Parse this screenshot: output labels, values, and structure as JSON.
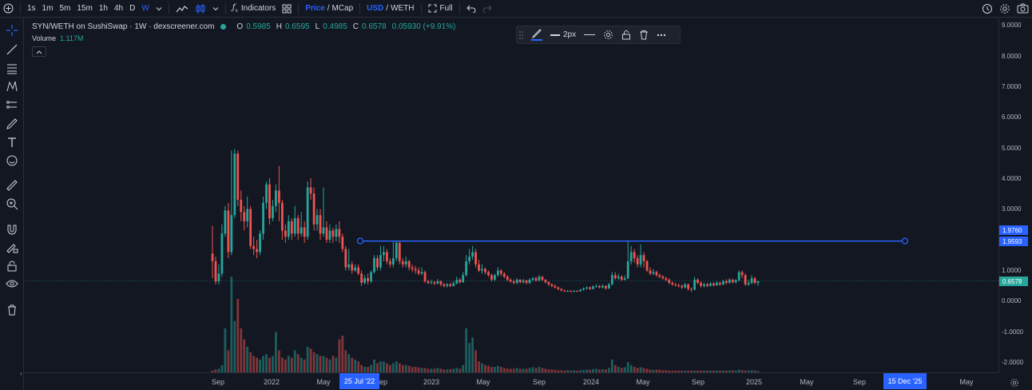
{
  "toolbar": {
    "intervals": [
      "1s",
      "1m",
      "5m",
      "15m",
      "1h",
      "4h",
      "D",
      "W"
    ],
    "active_interval": "W",
    "indicators_label": "Indicators",
    "price_label": "Price",
    "mcap_label": "MCap",
    "slash": "/",
    "usd_label": "USD",
    "weth_label": "WETH",
    "full_label": "Full"
  },
  "legend": {
    "symbol": "SYN/WETH on SushiSwap · 1W · dexscreener.com",
    "o_key": "O",
    "o_val": "0.5985",
    "h_key": "H",
    "h_val": "0.6595",
    "l_key": "L",
    "l_val": "0.4985",
    "c_key": "C",
    "c_val": "0.6578",
    "change": "0.05930 (+9.91%)",
    "volume_key": "Volume",
    "volume_val": "1.117M"
  },
  "drawing_toolbar": {
    "width_label": "2px"
  },
  "price_axis": {
    "labels": [
      "9.0000",
      "8.0000",
      "7.0000",
      "6.0000",
      "5.0000",
      "4.0000",
      "3.0000",
      "1.0000",
      "0.0000",
      "-1.0000",
      "-2.0000"
    ],
    "tag_line_top": "1.9760",
    "tag_line_bottom": "1.9593",
    "tag_current": "0.6578"
  },
  "time_axis": {
    "labels": [
      "Sep",
      "2022",
      "May",
      "Sep",
      "2023",
      "May",
      "Sep",
      "2024",
      "May",
      "Sep",
      "2025",
      "May",
      "Sep",
      "May"
    ],
    "tag_left": "25 Jul '22",
    "tag_right": "15 Dec '25"
  },
  "colors": {
    "up": "#26a69a",
    "down": "#ef5350",
    "line": "#2962ff",
    "bg": "#131722"
  },
  "chart_data": {
    "type": "candlestick",
    "current_price": 0.6578,
    "horizontal_line": 1.9593,
    "candles": [
      {
        "o": 1.55,
        "c": 1.3,
        "h": 2.45,
        "l": 0.75
      },
      {
        "o": 1.3,
        "c": 0.65,
        "h": 1.45,
        "l": 0.55
      },
      {
        "o": 0.65,
        "c": 0.9,
        "h": 1.2,
        "l": 0.55
      },
      {
        "o": 0.9,
        "c": 2.2,
        "h": 2.5,
        "l": 0.8
      },
      {
        "o": 2.2,
        "c": 2.95,
        "h": 3.1,
        "l": 2.1
      },
      {
        "o": 2.95,
        "c": 1.6,
        "h": 3.2,
        "l": 1.4
      },
      {
        "o": 1.6,
        "c": 2.8,
        "h": 4.9,
        "l": 1.5
      },
      {
        "o": 2.8,
        "c": 4.8,
        "h": 4.95,
        "l": 2.7
      },
      {
        "o": 4.8,
        "c": 3.3,
        "h": 4.9,
        "l": 3.1
      },
      {
        "o": 3.3,
        "c": 2.9,
        "h": 3.6,
        "l": 2.6
      },
      {
        "o": 2.9,
        "c": 2.6,
        "h": 3.1,
        "l": 2.3
      },
      {
        "o": 2.6,
        "c": 3.0,
        "h": 3.4,
        "l": 2.4
      },
      {
        "o": 3.0,
        "c": 1.8,
        "h": 3.1,
        "l": 1.7
      },
      {
        "o": 1.8,
        "c": 1.7,
        "h": 2.1,
        "l": 1.5
      },
      {
        "o": 1.7,
        "c": 1.6,
        "h": 2.0,
        "l": 1.4
      },
      {
        "o": 1.6,
        "c": 2.2,
        "h": 2.3,
        "l": 1.5
      },
      {
        "o": 2.2,
        "c": 3.2,
        "h": 3.4,
        "l": 2.0
      },
      {
        "o": 3.2,
        "c": 3.8,
        "h": 3.9,
        "l": 3.0
      },
      {
        "o": 3.8,
        "c": 2.7,
        "h": 4.0,
        "l": 2.5
      },
      {
        "o": 2.7,
        "c": 3.1,
        "h": 3.3,
        "l": 2.6
      },
      {
        "o": 3.1,
        "c": 3.6,
        "h": 3.8,
        "l": 2.9
      },
      {
        "o": 3.6,
        "c": 3.2,
        "h": 4.4,
        "l": 2.6
      },
      {
        "o": 3.2,
        "c": 2.3,
        "h": 3.3,
        "l": 2.0
      },
      {
        "o": 2.3,
        "c": 2.1,
        "h": 2.5,
        "l": 1.9
      },
      {
        "o": 2.1,
        "c": 2.6,
        "h": 2.8,
        "l": 2.0
      },
      {
        "o": 2.6,
        "c": 2.2,
        "h": 2.7,
        "l": 2.0
      },
      {
        "o": 2.2,
        "c": 2.7,
        "h": 3.1,
        "l": 2.1
      },
      {
        "o": 2.7,
        "c": 2.2,
        "h": 2.8,
        "l": 2.0
      },
      {
        "o": 2.2,
        "c": 2.4,
        "h": 2.9,
        "l": 2.1
      },
      {
        "o": 2.4,
        "c": 2.1,
        "h": 2.6,
        "l": 1.9
      },
      {
        "o": 2.1,
        "c": 3.7,
        "h": 3.9,
        "l": 2.0
      },
      {
        "o": 3.7,
        "c": 3.5,
        "h": 4.0,
        "l": 3.3
      },
      {
        "o": 3.5,
        "c": 2.5,
        "h": 3.7,
        "l": 2.3
      },
      {
        "o": 2.5,
        "c": 2.8,
        "h": 3.0,
        "l": 2.3
      },
      {
        "o": 2.8,
        "c": 2.2,
        "h": 3.0,
        "l": 2.0
      },
      {
        "o": 2.2,
        "c": 2.4,
        "h": 3.7,
        "l": 2.1
      },
      {
        "o": 2.4,
        "c": 2.0,
        "h": 2.6,
        "l": 1.9
      },
      {
        "o": 2.0,
        "c": 2.3,
        "h": 2.5,
        "l": 1.9
      },
      {
        "o": 2.3,
        "c": 2.1,
        "h": 2.4,
        "l": 1.9
      },
      {
        "o": 2.1,
        "c": 2.35,
        "h": 2.5,
        "l": 1.95
      },
      {
        "o": 2.35,
        "c": 2.1,
        "h": 2.6,
        "l": 1.9
      },
      {
        "o": 2.1,
        "c": 1.7,
        "h": 2.2,
        "l": 1.6
      },
      {
        "o": 1.7,
        "c": 1.1,
        "h": 1.8,
        "l": 1.0
      },
      {
        "o": 1.1,
        "c": 1.2,
        "h": 1.7,
        "l": 1.0
      },
      {
        "o": 1.2,
        "c": 1.0,
        "h": 1.3,
        "l": 0.9
      },
      {
        "o": 1.0,
        "c": 1.1,
        "h": 1.2,
        "l": 0.95
      },
      {
        "o": 1.1,
        "c": 0.9,
        "h": 1.2,
        "l": 0.85
      },
      {
        "o": 0.9,
        "c": 0.6,
        "h": 1.0,
        "l": 0.5
      },
      {
        "o": 0.6,
        "c": 0.75,
        "h": 0.85,
        "l": 0.55
      },
      {
        "o": 0.75,
        "c": 0.65,
        "h": 0.9,
        "l": 0.55
      },
      {
        "o": 0.65,
        "c": 0.95,
        "h": 1.0,
        "l": 0.6
      },
      {
        "o": 0.95,
        "c": 1.4,
        "h": 1.5,
        "l": 0.9
      },
      {
        "o": 1.4,
        "c": 1.1,
        "h": 1.5,
        "l": 1.0
      },
      {
        "o": 1.1,
        "c": 1.5,
        "h": 1.8,
        "l": 1.0
      },
      {
        "o": 1.5,
        "c": 1.6,
        "h": 1.8,
        "l": 1.3
      },
      {
        "o": 1.6,
        "c": 1.3,
        "h": 1.7,
        "l": 1.2
      },
      {
        "o": 1.3,
        "c": 1.2,
        "h": 1.4,
        "l": 1.1
      },
      {
        "o": 1.2,
        "c": 1.4,
        "h": 1.96,
        "l": 1.1
      },
      {
        "o": 1.4,
        "c": 1.9,
        "h": 1.96,
        "l": 1.3
      },
      {
        "o": 1.9,
        "c": 1.3,
        "h": 1.95,
        "l": 1.2
      },
      {
        "o": 1.3,
        "c": 1.2,
        "h": 1.4,
        "l": 1.1
      },
      {
        "o": 1.2,
        "c": 1.3,
        "h": 1.45,
        "l": 1.1
      },
      {
        "o": 1.3,
        "c": 1.1,
        "h": 1.35,
        "l": 1.0
      },
      {
        "o": 1.1,
        "c": 1.05,
        "h": 1.2,
        "l": 0.95
      },
      {
        "o": 1.05,
        "c": 1.0,
        "h": 1.15,
        "l": 0.9
      },
      {
        "o": 1.0,
        "c": 0.9,
        "h": 1.1,
        "l": 0.85
      },
      {
        "o": 0.9,
        "c": 0.95,
        "h": 1.1,
        "l": 0.85
      },
      {
        "o": 0.95,
        "c": 0.65,
        "h": 1.0,
        "l": 0.6
      },
      {
        "o": 0.65,
        "c": 0.6,
        "h": 0.7,
        "l": 0.55
      },
      {
        "o": 0.6,
        "c": 0.62,
        "h": 0.7,
        "l": 0.55
      },
      {
        "o": 0.62,
        "c": 0.58,
        "h": 0.66,
        "l": 0.52
      },
      {
        "o": 0.58,
        "c": 0.65,
        "h": 0.72,
        "l": 0.55
      },
      {
        "o": 0.65,
        "c": 0.55,
        "h": 0.68,
        "l": 0.48
      },
      {
        "o": 0.55,
        "c": 0.5,
        "h": 0.6,
        "l": 0.45
      },
      {
        "o": 0.5,
        "c": 0.55,
        "h": 0.6,
        "l": 0.45
      },
      {
        "o": 0.55,
        "c": 0.5,
        "h": 0.6,
        "l": 0.46
      },
      {
        "o": 0.5,
        "c": 0.58,
        "h": 0.65,
        "l": 0.48
      },
      {
        "o": 0.58,
        "c": 0.7,
        "h": 0.8,
        "l": 0.55
      },
      {
        "o": 0.7,
        "c": 0.62,
        "h": 0.75,
        "l": 0.58
      },
      {
        "o": 0.62,
        "c": 0.85,
        "h": 0.95,
        "l": 0.6
      },
      {
        "o": 0.85,
        "c": 1.3,
        "h": 1.5,
        "l": 0.8
      },
      {
        "o": 1.3,
        "c": 1.45,
        "h": 1.7,
        "l": 1.2
      },
      {
        "o": 1.45,
        "c": 1.6,
        "h": 1.8,
        "l": 1.35
      },
      {
        "o": 1.6,
        "c": 1.2,
        "h": 1.7,
        "l": 1.1
      },
      {
        "o": 1.2,
        "c": 1.0,
        "h": 1.35,
        "l": 0.95
      },
      {
        "o": 1.0,
        "c": 1.05,
        "h": 1.2,
        "l": 0.9
      },
      {
        "o": 1.05,
        "c": 0.95,
        "h": 1.1,
        "l": 0.88
      },
      {
        "o": 0.95,
        "c": 0.85,
        "h": 1.0,
        "l": 0.8
      },
      {
        "o": 0.85,
        "c": 0.7,
        "h": 0.9,
        "l": 0.65
      },
      {
        "o": 0.7,
        "c": 0.85,
        "h": 0.9,
        "l": 0.65
      },
      {
        "o": 0.85,
        "c": 1.0,
        "h": 1.1,
        "l": 0.8
      },
      {
        "o": 1.0,
        "c": 0.9,
        "h": 1.05,
        "l": 0.82
      },
      {
        "o": 0.9,
        "c": 0.8,
        "h": 0.95,
        "l": 0.75
      },
      {
        "o": 0.8,
        "c": 0.7,
        "h": 0.85,
        "l": 0.65
      },
      {
        "o": 0.7,
        "c": 0.65,
        "h": 0.75,
        "l": 0.6
      },
      {
        "o": 0.65,
        "c": 0.6,
        "h": 0.7,
        "l": 0.55
      },
      {
        "o": 0.6,
        "c": 0.7,
        "h": 0.75,
        "l": 0.55
      },
      {
        "o": 0.7,
        "c": 0.62,
        "h": 0.72,
        "l": 0.58
      },
      {
        "o": 0.62,
        "c": 0.68,
        "h": 0.72,
        "l": 0.58
      },
      {
        "o": 0.68,
        "c": 0.6,
        "h": 0.7,
        "l": 0.55
      },
      {
        "o": 0.6,
        "c": 0.7,
        "h": 0.75,
        "l": 0.56
      },
      {
        "o": 0.7,
        "c": 0.75,
        "h": 0.8,
        "l": 0.65
      },
      {
        "o": 0.75,
        "c": 0.68,
        "h": 0.8,
        "l": 0.63
      },
      {
        "o": 0.68,
        "c": 0.8,
        "h": 0.85,
        "l": 0.65
      },
      {
        "o": 0.8,
        "c": 0.7,
        "h": 0.82,
        "l": 0.66
      },
      {
        "o": 0.7,
        "c": 0.62,
        "h": 0.72,
        "l": 0.58
      },
      {
        "o": 0.62,
        "c": 0.55,
        "h": 0.65,
        "l": 0.5
      },
      {
        "o": 0.55,
        "c": 0.5,
        "h": 0.58,
        "l": 0.45
      },
      {
        "o": 0.5,
        "c": 0.45,
        "h": 0.55,
        "l": 0.42
      },
      {
        "o": 0.45,
        "c": 0.4,
        "h": 0.48,
        "l": 0.36
      },
      {
        "o": 0.4,
        "c": 0.35,
        "h": 0.43,
        "l": 0.32
      },
      {
        "o": 0.35,
        "c": 0.33,
        "h": 0.38,
        "l": 0.3
      },
      {
        "o": 0.33,
        "c": 0.34,
        "h": 0.37,
        "l": 0.3
      },
      {
        "o": 0.34,
        "c": 0.32,
        "h": 0.36,
        "l": 0.29
      },
      {
        "o": 0.32,
        "c": 0.34,
        "h": 0.37,
        "l": 0.3
      },
      {
        "o": 0.34,
        "c": 0.33,
        "h": 0.36,
        "l": 0.3
      },
      {
        "o": 0.33,
        "c": 0.38,
        "h": 0.4,
        "l": 0.31
      },
      {
        "o": 0.38,
        "c": 0.42,
        "h": 0.45,
        "l": 0.35
      },
      {
        "o": 0.42,
        "c": 0.45,
        "h": 0.48,
        "l": 0.38
      },
      {
        "o": 0.45,
        "c": 0.4,
        "h": 0.48,
        "l": 0.37
      },
      {
        "o": 0.4,
        "c": 0.48,
        "h": 0.52,
        "l": 0.38
      },
      {
        "o": 0.48,
        "c": 0.5,
        "h": 0.55,
        "l": 0.44
      },
      {
        "o": 0.5,
        "c": 0.45,
        "h": 0.53,
        "l": 0.42
      },
      {
        "o": 0.45,
        "c": 0.5,
        "h": 0.55,
        "l": 0.42
      },
      {
        "o": 0.5,
        "c": 0.42,
        "h": 0.52,
        "l": 0.38
      },
      {
        "o": 0.42,
        "c": 0.55,
        "h": 0.6,
        "l": 0.4
      },
      {
        "o": 0.55,
        "c": 0.85,
        "h": 0.95,
        "l": 0.52
      },
      {
        "o": 0.85,
        "c": 0.75,
        "h": 0.95,
        "l": 0.7
      },
      {
        "o": 0.75,
        "c": 0.8,
        "h": 0.9,
        "l": 0.7
      },
      {
        "o": 0.8,
        "c": 0.7,
        "h": 0.85,
        "l": 0.65
      },
      {
        "o": 0.7,
        "c": 0.75,
        "h": 0.85,
        "l": 0.68
      },
      {
        "o": 0.75,
        "c": 1.3,
        "h": 1.96,
        "l": 0.72
      },
      {
        "o": 1.3,
        "c": 1.6,
        "h": 1.8,
        "l": 1.2
      },
      {
        "o": 1.6,
        "c": 1.4,
        "h": 1.7,
        "l": 1.25
      },
      {
        "o": 1.4,
        "c": 1.2,
        "h": 1.5,
        "l": 1.1
      },
      {
        "o": 1.2,
        "c": 1.5,
        "h": 1.85,
        "l": 1.1
      },
      {
        "o": 1.5,
        "c": 1.3,
        "h": 1.6,
        "l": 1.1
      },
      {
        "o": 1.3,
        "c": 1.0,
        "h": 1.35,
        "l": 0.95
      },
      {
        "o": 1.0,
        "c": 0.9,
        "h": 1.1,
        "l": 0.85
      },
      {
        "o": 0.9,
        "c": 0.95,
        "h": 1.05,
        "l": 0.85
      },
      {
        "o": 0.95,
        "c": 0.85,
        "h": 1.0,
        "l": 0.8
      },
      {
        "o": 0.85,
        "c": 0.8,
        "h": 0.9,
        "l": 0.75
      },
      {
        "o": 0.8,
        "c": 0.75,
        "h": 0.85,
        "l": 0.7
      },
      {
        "o": 0.75,
        "c": 0.7,
        "h": 0.8,
        "l": 0.65
      },
      {
        "o": 0.7,
        "c": 0.6,
        "h": 0.75,
        "l": 0.55
      },
      {
        "o": 0.6,
        "c": 0.55,
        "h": 0.65,
        "l": 0.5
      },
      {
        "o": 0.55,
        "c": 0.52,
        "h": 0.6,
        "l": 0.48
      },
      {
        "o": 0.52,
        "c": 0.5,
        "h": 0.58,
        "l": 0.45
      },
      {
        "o": 0.5,
        "c": 0.45,
        "h": 0.55,
        "l": 0.4
      },
      {
        "o": 0.45,
        "c": 0.55,
        "h": 0.6,
        "l": 0.42
      },
      {
        "o": 0.55,
        "c": 0.4,
        "h": 0.58,
        "l": 0.35
      },
      {
        "o": 0.4,
        "c": 0.38,
        "h": 0.45,
        "l": 0.3
      },
      {
        "o": 0.38,
        "c": 0.7,
        "h": 0.8,
        "l": 0.35
      },
      {
        "o": 0.7,
        "c": 0.6,
        "h": 0.75,
        "l": 0.55
      },
      {
        "o": 0.6,
        "c": 0.5,
        "h": 0.65,
        "l": 0.45
      },
      {
        "o": 0.5,
        "c": 0.55,
        "h": 0.6,
        "l": 0.45
      },
      {
        "o": 0.55,
        "c": 0.5,
        "h": 0.6,
        "l": 0.46
      },
      {
        "o": 0.5,
        "c": 0.58,
        "h": 0.62,
        "l": 0.48
      },
      {
        "o": 0.58,
        "c": 0.52,
        "h": 0.62,
        "l": 0.48
      },
      {
        "o": 0.52,
        "c": 0.6,
        "h": 0.65,
        "l": 0.5
      },
      {
        "o": 0.6,
        "c": 0.55,
        "h": 0.64,
        "l": 0.5
      },
      {
        "o": 0.55,
        "c": 0.65,
        "h": 0.7,
        "l": 0.52
      },
      {
        "o": 0.65,
        "c": 0.6,
        "h": 0.72,
        "l": 0.55
      },
      {
        "o": 0.6,
        "c": 0.7,
        "h": 0.75,
        "l": 0.58
      },
      {
        "o": 0.7,
        "c": 0.62,
        "h": 0.74,
        "l": 0.58
      },
      {
        "o": 0.62,
        "c": 0.68,
        "h": 0.72,
        "l": 0.58
      },
      {
        "o": 0.68,
        "c": 0.95,
        "h": 1.0,
        "l": 0.65
      },
      {
        "o": 0.95,
        "c": 0.85,
        "h": 1.0,
        "l": 0.75
      },
      {
        "o": 0.85,
        "c": 0.55,
        "h": 0.9,
        "l": 0.5
      },
      {
        "o": 0.55,
        "c": 0.6,
        "h": 0.7,
        "l": 0.5
      },
      {
        "o": 0.6,
        "c": 0.75,
        "h": 0.85,
        "l": 0.55
      },
      {
        "o": 0.75,
        "c": 0.6,
        "h": 0.8,
        "l": 0.55
      },
      {
        "o": 0.5985,
        "c": 0.6578,
        "h": 0.6595,
        "l": 0.4985
      }
    ],
    "volumes": [
      0.05,
      0.08,
      0.1,
      0.2,
      1.2,
      0.6,
      2.6,
      1.4,
      2.0,
      1.2,
      0.9,
      0.7,
      0.55,
      0.45,
      0.4,
      0.35,
      0.45,
      0.5,
      0.4,
      0.45,
      1.1,
      0.6,
      0.4,
      0.35,
      0.45,
      0.4,
      0.6,
      0.5,
      0.4,
      0.35,
      0.7,
      0.65,
      0.55,
      0.5,
      0.45,
      0.45,
      0.4,
      0.35,
      0.45,
      0.4,
      0.9,
      1.0,
      0.6,
      0.5,
      0.4,
      0.35,
      0.3,
      0.2,
      0.15,
      0.15,
      0.2,
      0.35,
      0.25,
      0.3,
      0.3,
      0.25,
      0.2,
      0.25,
      0.3,
      0.25,
      0.2,
      0.2,
      0.18,
      0.15,
      0.15,
      0.14,
      0.12,
      0.12,
      0.1,
      0.1,
      0.1,
      0.12,
      0.1,
      0.08,
      0.08,
      0.09,
      0.1,
      0.12,
      0.1,
      0.2,
      1.2,
      0.8,
      0.95,
      0.6,
      0.3,
      0.25,
      0.2,
      0.18,
      0.15,
      0.15,
      0.18,
      0.15,
      0.12,
      0.1,
      0.1,
      0.1,
      0.12,
      0.1,
      0.1,
      0.1,
      0.12,
      0.14,
      0.12,
      0.15,
      0.12,
      0.1,
      0.08,
      0.08,
      0.07,
      0.06,
      0.06,
      0.05,
      0.06,
      0.05,
      0.06,
      0.05,
      0.06,
      0.07,
      0.08,
      0.07,
      0.09,
      0.1,
      0.08,
      0.09,
      0.08,
      0.12,
      0.35,
      0.2,
      0.15,
      0.12,
      0.14,
      0.28,
      0.2,
      0.15,
      0.12,
      0.14,
      0.12,
      0.1,
      0.08,
      0.07,
      0.08,
      0.07,
      0.06,
      0.06,
      0.05,
      0.05,
      0.05,
      0.05,
      0.05,
      0.05,
      0.05,
      0.05,
      0.05,
      0.05,
      0.05,
      0.05,
      0.05,
      0.05,
      0.05,
      0.05,
      0.05,
      0.05,
      0.05,
      0.05,
      0.06,
      0.05,
      0.08,
      0.06,
      0.05,
      0.05,
      0.06,
      0.05,
      0.04
    ]
  }
}
